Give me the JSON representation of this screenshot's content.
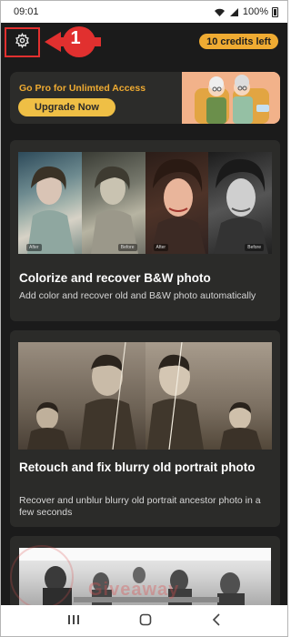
{
  "status_bar": {
    "time": "09:01",
    "battery": "100%"
  },
  "header": {
    "callout_number": "1",
    "credits": "10 credits left"
  },
  "promo": {
    "title": "Go Pro for Unlimted Access",
    "button": "Upgrade Now"
  },
  "cards": [
    {
      "title": "Colorize and recover B&W photo",
      "description": "Add color and recover old and B&W photo automatically",
      "image_tags": [
        "After",
        "Before",
        "After",
        "Before"
      ]
    },
    {
      "title": "Retouch and fix blurry old portrait photo",
      "description": "Recover and unblur blurry old portrait ancestor photo in a few seconds"
    }
  ],
  "watermark": "Giveaway",
  "colors": {
    "accent": "#efab32",
    "background": "#1b1b1b",
    "card": "#2b2b29",
    "annotation": "#e1302f"
  },
  "icons": [
    "settings-gear-icon",
    "wifi-icon",
    "signal-icon",
    "battery-icon",
    "recent-apps-icon",
    "home-icon",
    "back-icon"
  ]
}
